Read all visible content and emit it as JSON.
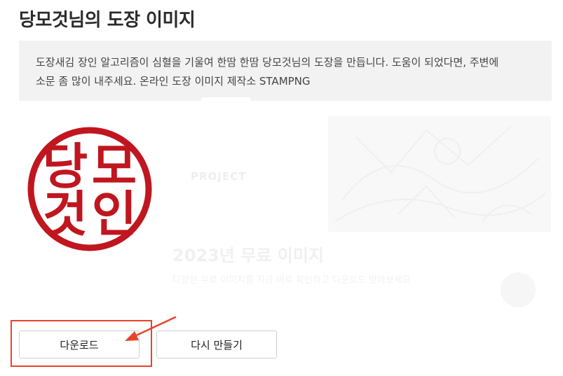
{
  "page": {
    "title": "당모것님의 도장 이미지"
  },
  "description": {
    "line1": "도장새김 장인 알고리즘이 심혈을 기울여 한땀 한땀 당모것님의 도장을 만듭니다. 도움이 되었다면, 주변에",
    "line2": "소문 좀 많이 내주세요. 온라인 도장 이미지 제작소 STAMPNG"
  },
  "stamp": {
    "chars": [
      "당",
      "모",
      "것",
      "인"
    ],
    "color": "#c0161f"
  },
  "ad": {
    "badge": "PROJECT",
    "heading": "2023년 무료 이미지",
    "text": "다양한 무료 이미지를 지금 바로 확인하고 다운로드 받아보세요"
  },
  "buttons": {
    "download_label": "다운로드",
    "remake_label": "다시 만들기"
  },
  "annotation": {
    "color": "#e8432a"
  }
}
